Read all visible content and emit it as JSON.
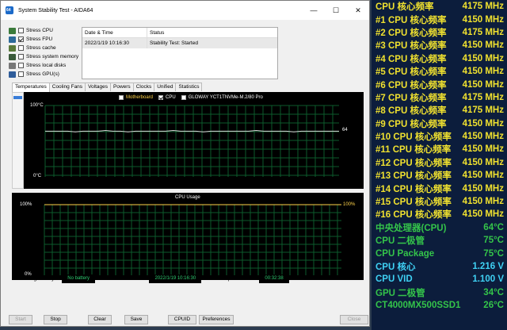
{
  "window": {
    "title": "System Stability Test - AIDA64",
    "min_glyph": "—",
    "max_glyph": "☐",
    "close_glyph": "✕"
  },
  "stress_options": [
    {
      "label": "Stress CPU",
      "checked": false,
      "icon": "cpu-icon",
      "color": "#3a7a3a"
    },
    {
      "label": "Stress FPU",
      "checked": true,
      "icon": "fpu-icon",
      "color": "#2d6a9a"
    },
    {
      "label": "Stress cache",
      "checked": false,
      "icon": "cache-icon",
      "color": "#5a7a3a"
    },
    {
      "label": "Stress system memory",
      "checked": false,
      "icon": "memory-icon",
      "color": "#3a5a3a"
    },
    {
      "label": "Stress local disks",
      "checked": false,
      "icon": "disk-icon",
      "color": "#777777"
    },
    {
      "label": "Stress GPU(s)",
      "checked": false,
      "icon": "gpu-icon",
      "color": "#2f5d9a"
    }
  ],
  "status_table": {
    "headers": [
      "Date & Time",
      "Status"
    ],
    "rows": [
      [
        "2022/1/19 10:16:30",
        "Stability Test: Started"
      ]
    ]
  },
  "tabs": [
    "Temperatures",
    "Cooling Fans",
    "Voltages",
    "Powers",
    "Clocks",
    "Unified",
    "Statistics"
  ],
  "temp_graph": {
    "legend": [
      {
        "label": "Motherboard",
        "checked": false,
        "color": "#ffd34a"
      },
      {
        "label": "CPU",
        "checked": true,
        "color": "#ffffff"
      },
      {
        "label": "GLOWAY YCT1TNVMe-M.2/80 Pro",
        "checked": false,
        "color": "#ffffff"
      }
    ],
    "y_max_label": "100°C",
    "y_min_label": "0°C",
    "current_value_label": "64"
  },
  "usage_graph": {
    "title": "CPU Usage",
    "y_max_label": "100%",
    "y_min_label": "0%",
    "current_value_label": "100%"
  },
  "chart_data": [
    {
      "type": "line",
      "title": "",
      "ylim": [
        0,
        100
      ],
      "ylabel": "°C",
      "series": [
        {
          "name": "CPU",
          "values": [
            64,
            64,
            64,
            64,
            63,
            64,
            64,
            64,
            65,
            64,
            64,
            63,
            64,
            64,
            64,
            64,
            64,
            65,
            64,
            64,
            64,
            63,
            64,
            64,
            64,
            64,
            64,
            64,
            65,
            64,
            64,
            64,
            64,
            63,
            64,
            64,
            64,
            64,
            64,
            64
          ]
        }
      ]
    },
    {
      "type": "line",
      "title": "CPU Usage",
      "ylim": [
        0,
        100
      ],
      "series": [
        {
          "name": "",
          "values": [
            100,
            100,
            100,
            100,
            100,
            100,
            100,
            100,
            100,
            100,
            100,
            100,
            100,
            100,
            100,
            100,
            100,
            100,
            100,
            100
          ]
        }
      ]
    }
  ],
  "info": {
    "battery_label": "Remaining Battery:",
    "battery_value": "No battery",
    "started_label": "Test Started:",
    "started_value": "2022/1/19 10:16:30",
    "elapsed_label": "Elapsed Time:",
    "elapsed_value": "00:32:38"
  },
  "buttons": {
    "start": "Start",
    "stop": "Stop",
    "clear": "Clear",
    "save": "Save",
    "cpuid": "CPUID",
    "preferences": "Preferences",
    "close": "Close"
  },
  "osd": [
    {
      "label": "CPU 核心频率",
      "value": "4175 MHz",
      "color": "yellow"
    },
    {
      "label": "#1 CPU 核心频率",
      "value": "4150 MHz",
      "color": "yellow"
    },
    {
      "label": "#2 CPU 核心频率",
      "value": "4175 MHz",
      "color": "yellow"
    },
    {
      "label": "#3 CPU 核心频率",
      "value": "4150 MHz",
      "color": "yellow"
    },
    {
      "label": "#4 CPU 核心频率",
      "value": "4150 MHz",
      "color": "yellow"
    },
    {
      "label": "#5 CPU 核心频率",
      "value": "4150 MHz",
      "color": "yellow"
    },
    {
      "label": "#6 CPU 核心频率",
      "value": "4150 MHz",
      "color": "yellow"
    },
    {
      "label": "#7 CPU 核心频率",
      "value": "4175 MHz",
      "color": "yellow"
    },
    {
      "label": "#8 CPU 核心频率",
      "value": "4175 MHz",
      "color": "yellow"
    },
    {
      "label": "#9 CPU 核心频率",
      "value": "4150 MHz",
      "color": "yellow"
    },
    {
      "label": "#10 CPU 核心频率",
      "value": "4150 MHz",
      "color": "yellow"
    },
    {
      "label": "#11 CPU 核心频率",
      "value": "4150 MHz",
      "color": "yellow"
    },
    {
      "label": "#12 CPU 核心频率",
      "value": "4150 MHz",
      "color": "yellow"
    },
    {
      "label": "#13 CPU 核心频率",
      "value": "4150 MHz",
      "color": "yellow"
    },
    {
      "label": "#14 CPU 核心频率",
      "value": "4150 MHz",
      "color": "yellow"
    },
    {
      "label": "#15 CPU 核心频率",
      "value": "4150 MHz",
      "color": "yellow"
    },
    {
      "label": "#16 CPU 核心频率",
      "value": "4150 MHz",
      "color": "yellow"
    },
    {
      "label": "中央处理器(CPU)",
      "value": "64°C",
      "color": "green"
    },
    {
      "label": "CPU 二极管",
      "value": "75°C",
      "color": "green"
    },
    {
      "label": "CPU Package",
      "value": "75°C",
      "color": "green"
    },
    {
      "label": "CPU 核心",
      "value": "1.216 V",
      "color": "cyan"
    },
    {
      "label": "CPU VID",
      "value": "1.100 V",
      "color": "cyan"
    },
    {
      "label": "GPU 二极管",
      "value": "34°C",
      "color": "green"
    },
    {
      "label": "CT4000MX500SSD1",
      "value": "26°C",
      "color": "green"
    }
  ]
}
